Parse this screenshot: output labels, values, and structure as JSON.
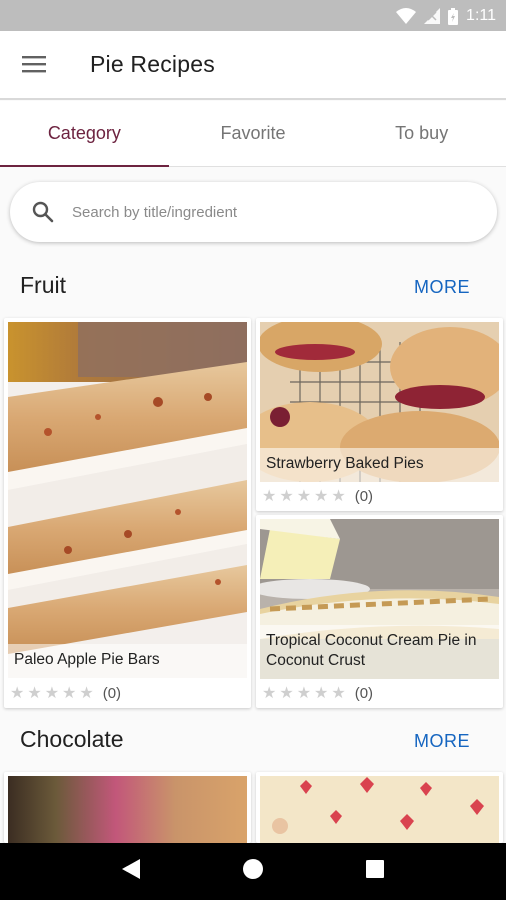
{
  "status_bar": {
    "time": "1:11"
  },
  "app_bar": {
    "title": "Pie Recipes"
  },
  "tabs": [
    {
      "label": "Category",
      "active": true
    },
    {
      "label": "Favorite",
      "active": false
    },
    {
      "label": "To buy",
      "active": false
    }
  ],
  "search": {
    "placeholder": "Search by title/ingredient"
  },
  "sections": [
    {
      "title": "Fruit",
      "more_label": "MORE",
      "cards": [
        {
          "title": "Paleo Apple Pie Bars",
          "rating_count": "(0)",
          "stars": 0
        },
        {
          "title": "Strawberry Baked Pies",
          "rating_count": "(0)",
          "stars": 0
        },
        {
          "title": "Tropical Coconut Cream Pie in Coconut Crust",
          "rating_count": "(0)",
          "stars": 0
        }
      ]
    },
    {
      "title": "Chocolate",
      "more_label": "MORE",
      "cards": []
    }
  ],
  "colors": {
    "accent": "#6d2340",
    "link": "#1565c0",
    "status_bar": "#bdbdbd",
    "nav_bar": "#000000"
  }
}
